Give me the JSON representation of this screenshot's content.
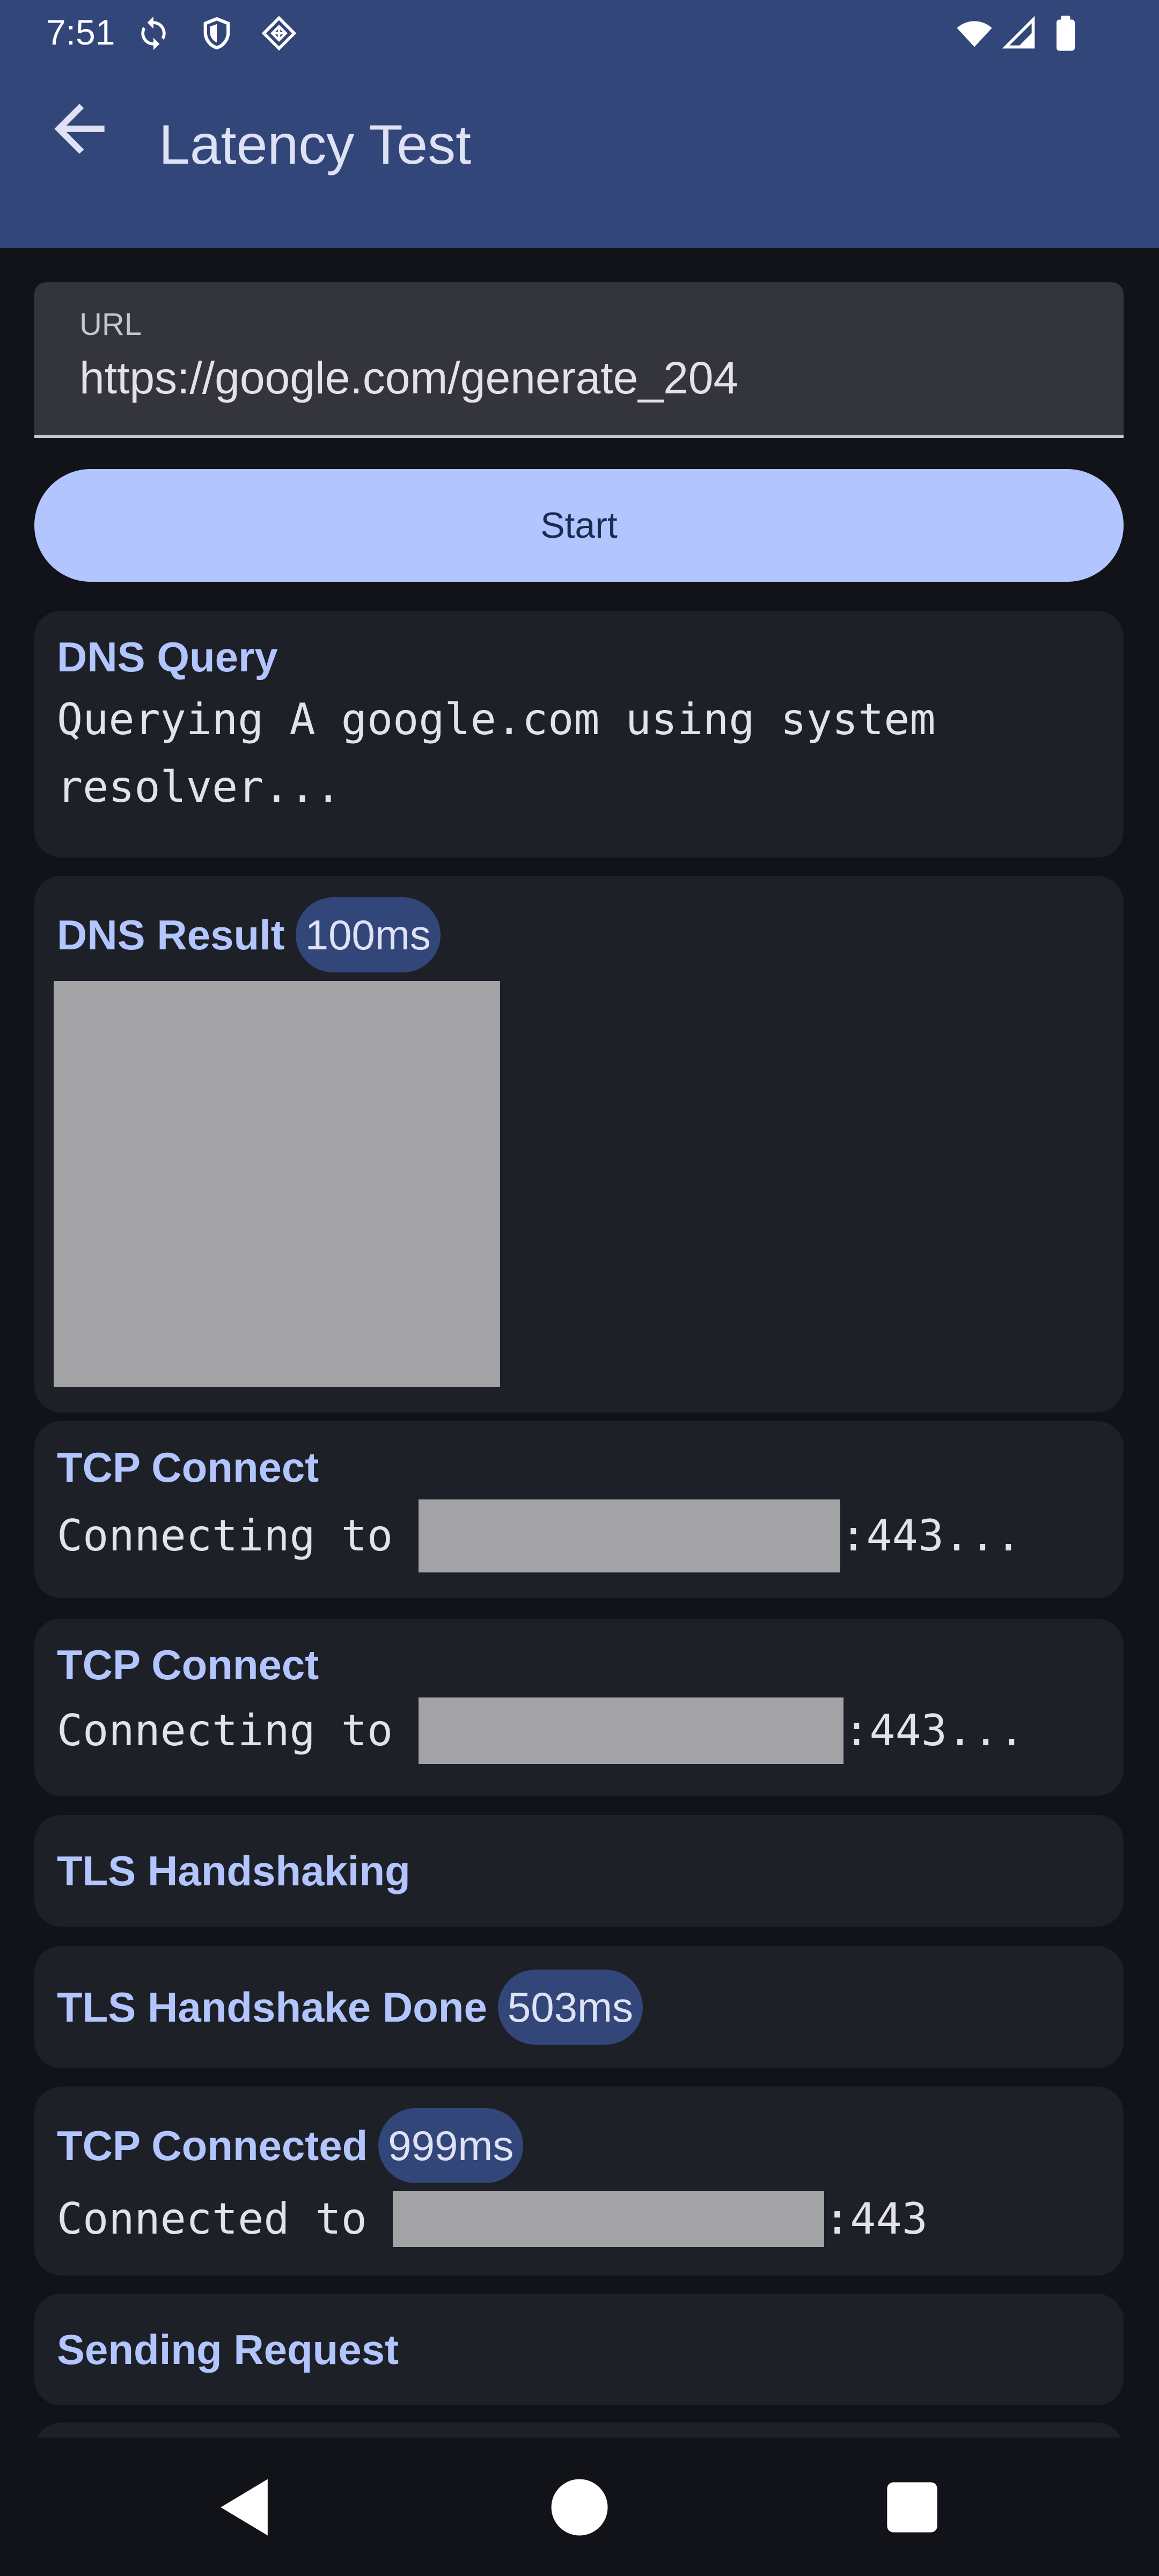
{
  "status_bar": {
    "time": "7:51",
    "left_icons": [
      "sync-icon",
      "shield-icon",
      "vpn-diamond-icon"
    ],
    "right_icons": [
      "wifi-icon",
      "signal-icon",
      "battery-icon"
    ]
  },
  "app_bar": {
    "title": "Latency Test",
    "back_icon": "arrow-back-icon"
  },
  "url_field": {
    "label": "URL",
    "value": "https://google.com/generate_204"
  },
  "start_button": {
    "label": "Start"
  },
  "steps": [
    {
      "title": "DNS Query",
      "line1": "Querying A google.com using system",
      "line2": "resolver..."
    },
    {
      "title": "DNS Result",
      "badge": "100ms"
    },
    {
      "title": "TCP Connect",
      "prefix": "Connecting to ",
      "suffix": ":443..."
    },
    {
      "title": "TCP Connect",
      "prefix": "Connecting to ",
      "suffix": ":443..."
    },
    {
      "title": "TLS Handshaking"
    },
    {
      "title": "TLS Handshake Done",
      "badge": "503ms"
    },
    {
      "title": "TCP Connected",
      "badge": "999ms",
      "prefix": "Connected to ",
      "suffix": ":443"
    },
    {
      "title": "Sending Request"
    }
  ],
  "nav_bar": {
    "icons": [
      "back-triangle-icon",
      "home-circle-icon",
      "recents-square-icon"
    ]
  },
  "colors": {
    "app_bar": "#324679",
    "background": "#111318",
    "card": "#1d2026",
    "accent": "#b2c5ff",
    "badge": "#324679",
    "redaction": "#a3a2a5"
  }
}
